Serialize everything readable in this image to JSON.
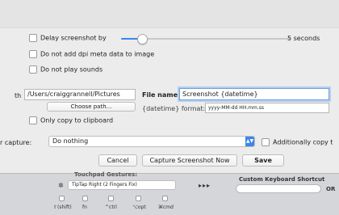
{
  "options": {
    "delay_label": "Delay screenshot by",
    "delay_seconds": 5,
    "delay_value_label": "5 seconds",
    "slider_level": 0.12,
    "dpi_label": "Do not add dpi meta data to image",
    "sounds_label": "Do not play sounds"
  },
  "save": {
    "path_prefix": "th",
    "path_value": "/Users/craiggrannell/Pictures",
    "choose_path_label": "Choose path...",
    "file_name_label": "File name",
    "file_name_value": "Screenshot {datetime}",
    "datetime_format_label": "{datetime} format:",
    "datetime_format_value": "yyyy-MM-dd HH.mm.ss",
    "clipboard_label": "Only copy to clipboard"
  },
  "after_capture": {
    "label": "r capture:",
    "selected": "Do nothing",
    "additionally_label": "Additionally copy t"
  },
  "buttons": {
    "cancel": "Cancel",
    "capture": "Capture Screenshot Now",
    "save": "Save"
  },
  "background_app": {
    "gestures_label": "Touchpad Gestures:",
    "gesture_value": "TipTap Right (2 Fingers Fix)",
    "arrows": "▸▸▸",
    "shortcut_label": "Custom Keyboard Shortcut",
    "or_label": "OR",
    "mod_shift": "⇧(shift)",
    "mod_fn": "fn",
    "mod_ctrl": "^ctrl",
    "mod_opt": "⌥opt",
    "mod_cmd": "⌘cmd"
  }
}
